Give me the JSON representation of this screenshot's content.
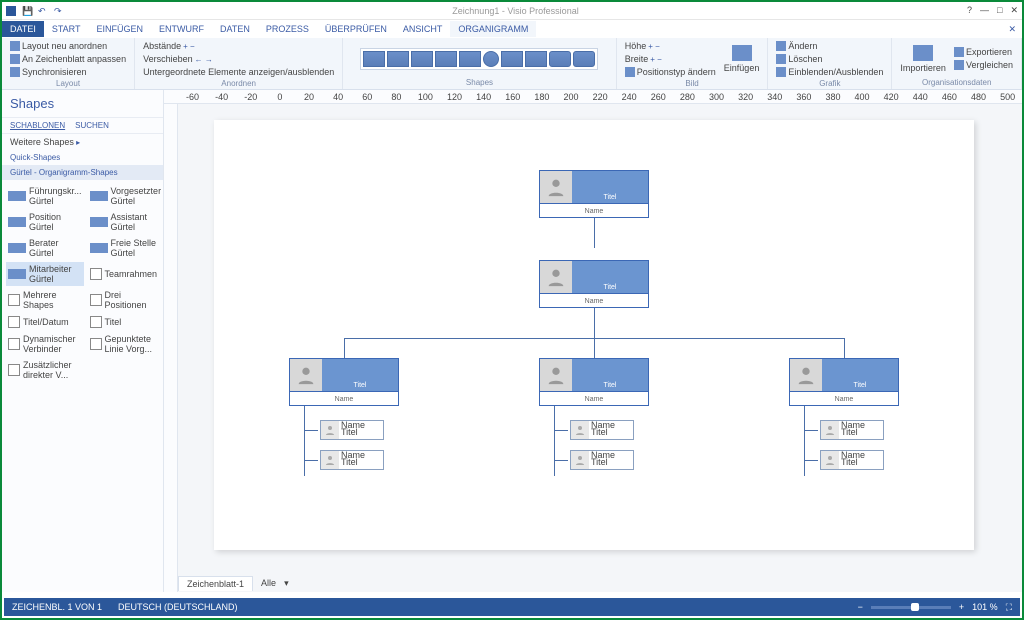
{
  "title": {
    "app": "Zeichnung1 - Visio Professional"
  },
  "menu": {
    "file": "DATEI",
    "start": "START",
    "einf": "EINFÜGEN",
    "entwurf": "ENTWURF",
    "daten": "DATEN",
    "prozess": "PROZESS",
    "ueber": "ÜBERPRÜFEN",
    "ansicht": "ANSICHT",
    "org": "ORGANIGRAMM"
  },
  "ribbon": {
    "layout": {
      "b1": "Layout neu anordnen",
      "b2": "An Zeichenblatt anpassen",
      "b3": "Synchronisieren",
      "label": "Layout"
    },
    "anordnen": {
      "b1": "Abstände",
      "b2": "Verschieben",
      "b3": "Untergeordnete Elemente anzeigen/ausblenden",
      "label": "Anordnen"
    },
    "shapes": {
      "label": "Shapes"
    },
    "bild": {
      "b1": "Höhe",
      "b2": "Breite",
      "b3": "Positionstyp ändern",
      "label": "Bild",
      "einf": "Einfügen"
    },
    "grafik": {
      "b1": "Ändern",
      "b2": "Löschen",
      "b3": "Einblenden/Ausblenden",
      "label": "Grafik"
    },
    "orgdata": {
      "b1": "Importieren",
      "b2": "Exportieren",
      "b3": "Vergleichen",
      "label": "Organisationsdaten"
    }
  },
  "sidebar": {
    "title": "Shapes",
    "t1": "SCHABLONEN",
    "t2": "SUCHEN",
    "more": "Weitere Shapes",
    "quick": "Quick-Shapes",
    "cat": "Gürtel - Organigramm-Shapes",
    "items": [
      {
        "l": "Führungskr... Gürtel"
      },
      {
        "l": "Vorgesetzter Gürtel"
      },
      {
        "l": "Position Gürtel"
      },
      {
        "l": "Assistant Gürtel"
      },
      {
        "l": "Berater Gürtel"
      },
      {
        "l": "Freie Stelle Gürtel"
      },
      {
        "l": "Mitarbeiter Gürtel"
      },
      {
        "l": "Teamrahmen"
      },
      {
        "l": "Mehrere Shapes"
      },
      {
        "l": "Drei Positionen"
      },
      {
        "l": "Titel/Datum"
      },
      {
        "l": "Titel"
      },
      {
        "l": "Dynamischer Verbinder"
      },
      {
        "l": "Gepunktete Linie Vorg..."
      },
      {
        "l": "Zusätzlicher direkter V..."
      }
    ]
  },
  "card": {
    "title": "Titel",
    "name": "Name"
  },
  "sub": {
    "name": "Name",
    "title": "Titel"
  },
  "pagetab": {
    "p1": "Zeichenblatt-1",
    "all": "Alle"
  },
  "status": {
    "page": "ZEICHENBL. 1 VON 1",
    "lang": "DEUTSCH (DEUTSCHLAND)",
    "zoom": "101 %"
  },
  "ruler": [
    "-60",
    "-40",
    "-20",
    "0",
    "20",
    "40",
    "60",
    "80",
    "100",
    "120",
    "140",
    "160",
    "180",
    "200",
    "220",
    "240",
    "260",
    "280",
    "300",
    "320",
    "340",
    "360",
    "380",
    "400",
    "420",
    "440",
    "460",
    "480",
    "500"
  ]
}
